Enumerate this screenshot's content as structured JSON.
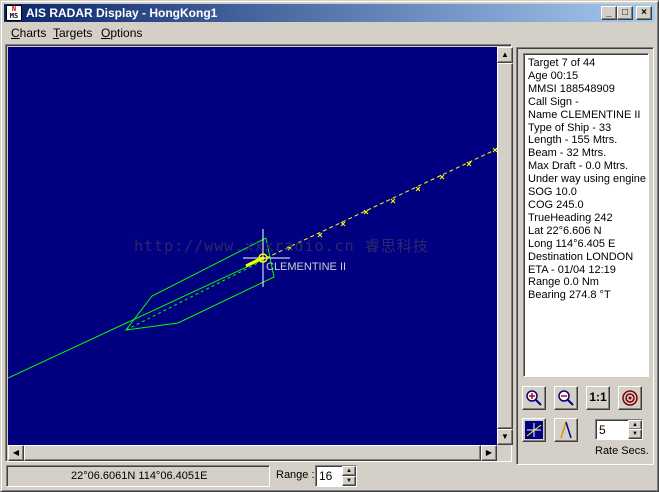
{
  "window": {
    "title": "AIS RADAR Display - HongKong1",
    "app_icon_top": "N",
    "app_icon_bottom": "MS",
    "minimize_glyph": "_",
    "maximize_glyph": "□",
    "close_glyph": "×"
  },
  "menu": {
    "charts": {
      "ul": "C",
      "rest": "harts"
    },
    "targets": {
      "ul": "T",
      "rest": "argets"
    },
    "options": {
      "ul": "O",
      "rest": "ptions"
    }
  },
  "radar": {
    "background_color": "#000080",
    "target_color": "#ffff00",
    "outline_color": "#00ff00",
    "cursor_color": "#ffffff",
    "ship_label": "CLEMENTINE II",
    "watermark": "http://www.xxxradio.cn 睿思科技"
  },
  "info": {
    "lines": [
      "Target 7 of 44",
      "Age 00:15",
      "MMSI 188548909",
      "Call Sign -",
      "Name CLEMENTINE II",
      "Type of Ship - 33",
      "Length - 155 Mtrs.",
      "Beam - 32 Mtrs.",
      "Max Draft - 0.0 Mtrs.",
      "Under way using engine",
      "SOG 10.0",
      "COG 245.0",
      "TrueHeading 242",
      "Lat 22°6.606 N",
      "Long 114°6.405 E",
      "Destination LONDON",
      "ETA - 01/04 12:19",
      "Range 0.0 Nm",
      "Bearing 274.8 °T"
    ]
  },
  "toolbar": {
    "zoom_in_icon": "zoom-in-icon",
    "zoom_out_icon": "zoom-out-icon",
    "reset_zoom_label": "1:1",
    "target_icon": "target-icon",
    "rate_value": "5",
    "rate_label": "Rate Secs."
  },
  "status": {
    "coordinates": "22°06.6061N 114°06.4051E",
    "range_label": "Range :",
    "range_value": "16"
  }
}
